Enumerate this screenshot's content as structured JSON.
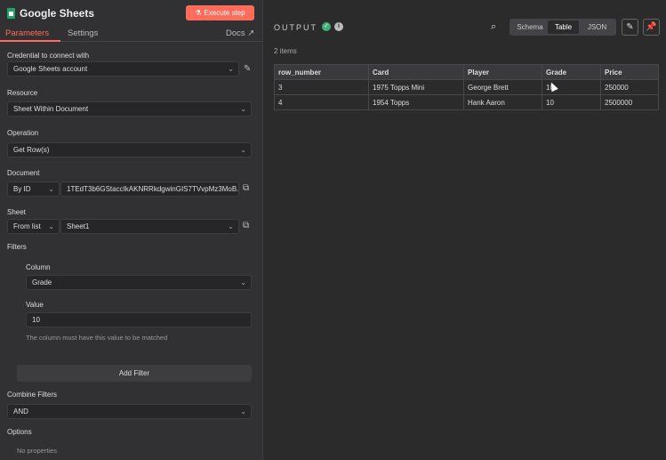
{
  "node": {
    "title": "Google Sheets",
    "execute_label": "Execute step"
  },
  "tabs": {
    "parameters": "Parameters",
    "settings": "Settings",
    "docs": "Docs"
  },
  "params": {
    "credential_label": "Credential to connect with",
    "credential_value": "Google Sheets account",
    "resource_label": "Resource",
    "resource_value": "Sheet Within Document",
    "operation_label": "Operation",
    "operation_value": "Get Row(s)",
    "document_label": "Document",
    "document_mode": "By ID",
    "document_value": "1TEdT3b6GStaccIkAKNRRkdgwinGIS7TVvpMz3MoB...",
    "sheet_label": "Sheet",
    "sheet_mode": "From list",
    "sheet_value": "Sheet1",
    "filters_label": "Filters",
    "column_label": "Column",
    "column_value": "Grade",
    "value_label": "Value",
    "value_value": "10",
    "value_hint": "The column must have this value to be matched",
    "add_filter": "Add Filter",
    "combine_label": "Combine Filters",
    "combine_value": "AND",
    "options_label": "Options",
    "options_value": "No properties"
  },
  "output": {
    "title": "OUTPUT",
    "items_count": "2 items",
    "view_modes": [
      "Schema",
      "Table",
      "JSON"
    ],
    "active_view": "Table",
    "columns": [
      "row_number",
      "Card",
      "Player",
      "Grade",
      "Price"
    ],
    "rows": [
      [
        "3",
        "1975 Topps Mini",
        "George Brett",
        "10",
        "250000"
      ],
      [
        "4",
        "1954 Topps",
        "Hank Aaron",
        "10",
        "2500000"
      ]
    ]
  },
  "colors": {
    "accent": "#ff6d5a",
    "success": "#3fb07a",
    "sheets_green": "#1fa463"
  }
}
